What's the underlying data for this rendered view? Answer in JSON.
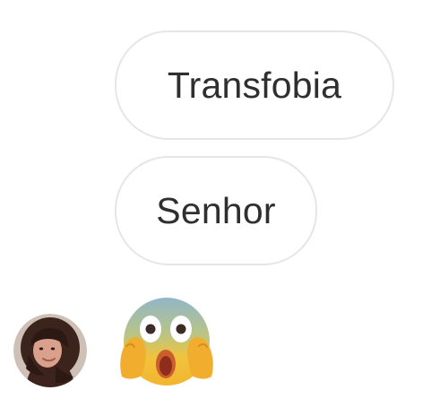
{
  "messages": [
    {
      "text": "Transfobia"
    },
    {
      "text": "Senhor"
    }
  ],
  "avatar": {
    "icon": "user-avatar-icon"
  },
  "reaction": {
    "icon": "face-screaming-in-fear-icon"
  }
}
